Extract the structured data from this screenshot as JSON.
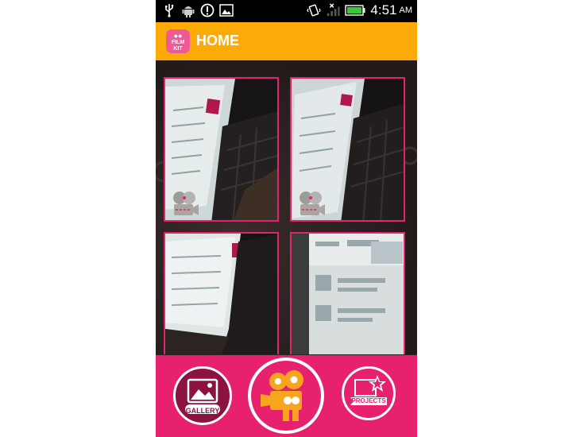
{
  "status_bar": {
    "time": "4:51",
    "ampm": "AM",
    "icons": [
      "usb-icon",
      "android-debug-icon",
      "alert-icon",
      "image-icon",
      "vibrate-icon",
      "no-signal-icon",
      "battery-icon"
    ]
  },
  "action_bar": {
    "logo_text_top": "FILM",
    "logo_text_bottom": "KIT",
    "title": "HOME",
    "color": "#fbaa07"
  },
  "grid": {
    "border_color": "#e0246f",
    "tiles": [
      {
        "has_video_badge": true
      },
      {
        "has_video_badge": true
      },
      {
        "has_video_badge": false
      },
      {
        "has_video_badge": false
      }
    ]
  },
  "bottom_bar": {
    "color": "#e8216e",
    "gallery_label": "GALLERY",
    "projects_label": "PROJECTS"
  }
}
